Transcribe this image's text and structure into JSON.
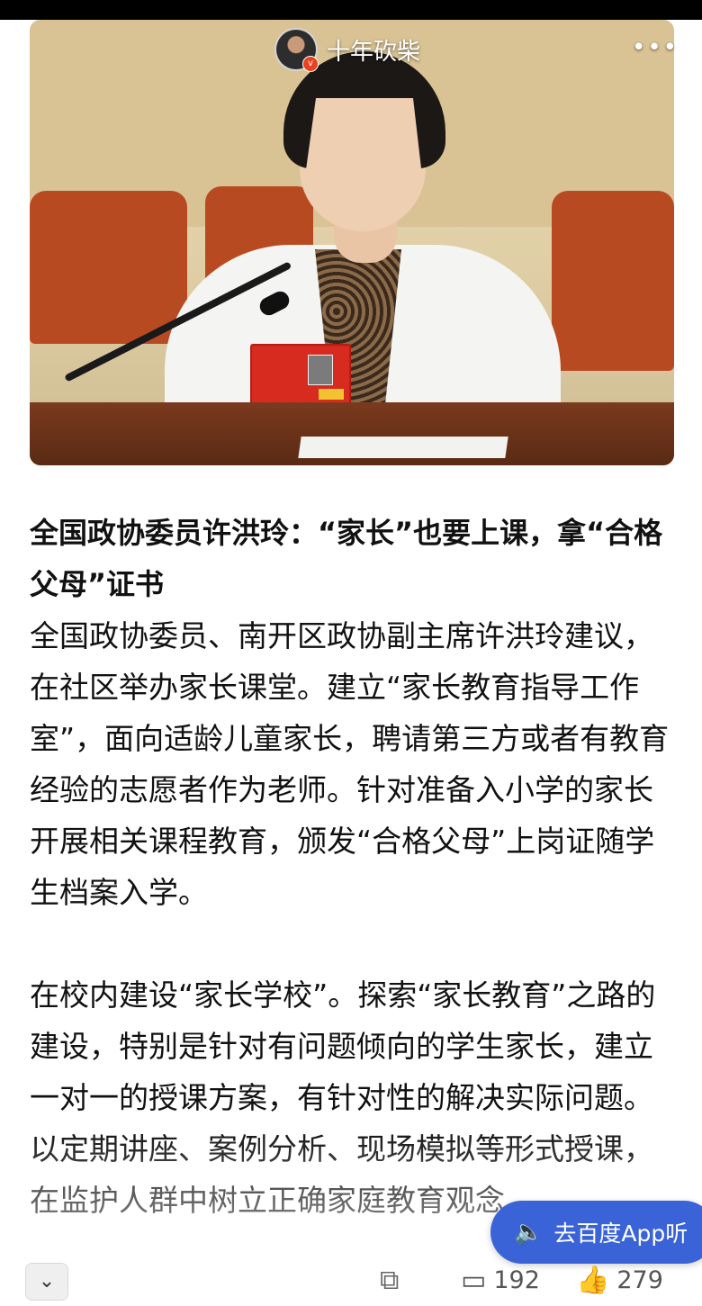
{
  "author": {
    "name": "十年砍柴",
    "verified_mark": "v"
  },
  "article": {
    "headline": "全国政协委员许洪玲：“家长”也要上课，拿“合格父母”证书",
    "paragraphs": [
      "全国政协委员、南开区政协副主席许洪玲建议，在社区举办家长课堂。建立“家长教育指导工作室”，面向适龄儿童家长，聘请第三方或者有教育经验的志愿者作为老师。针对准备入小学的家长开展相关课程教育，颁发“合格父母”上岗证随学生档案入学。",
      "在校内建设“家长学校”。探索“家长教育”之路的建设，特别是针对有问题倾向的学生家长，建立一对一的授课方案，有针对性的解决实际问题。以定期讲座、案例分析、现场模拟等形式授课，在监护人群中树立正确家庭教育观念。"
    ]
  },
  "listen_button": {
    "label": "去百度App听",
    "icon": "speaker-icon"
  },
  "bottom_bar": {
    "comment_count": "192",
    "like_count": "279"
  },
  "colors": {
    "accent": "#3a63d8",
    "verified": "#e8431f"
  }
}
